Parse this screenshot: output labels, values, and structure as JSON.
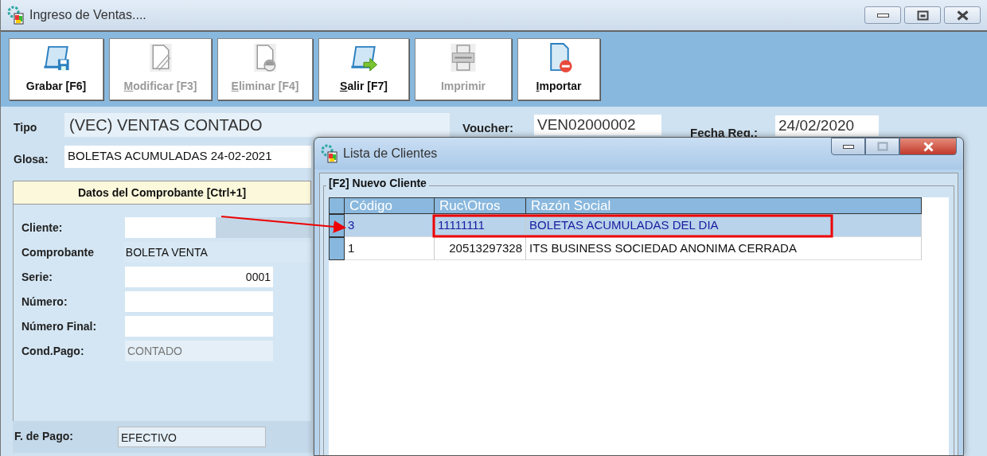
{
  "window": {
    "title": "Ingreso de Ventas...."
  },
  "toolbar": [
    {
      "label": "Grabar [F6]",
      "disabled": false,
      "mnemonic": false
    },
    {
      "label": "Modificar [F3]",
      "disabled": true,
      "mnemonic": true
    },
    {
      "label": "Eliminar [F4]",
      "disabled": true,
      "mnemonic": true
    },
    {
      "label": "Salir [F7]",
      "disabled": false,
      "mnemonic": true
    },
    {
      "label": "Imprimir",
      "disabled": true,
      "mnemonic": false
    },
    {
      "label": "Importar",
      "disabled": false,
      "mnemonic": true
    }
  ],
  "header": {
    "tipo_label": "Tipo",
    "tipo_value": "(VEC) VENTAS CONTADO",
    "voucher_label": "Voucher:",
    "voucher_value": "VEN02000002",
    "fecha_label": "Fecha Reg.:",
    "fecha_value": "24/02/2020",
    "glosa_label": "Glosa:",
    "glosa_value": "BOLETAS ACUMULADAS 24-02-2021"
  },
  "tab": {
    "label": "Datos del Comprobante [Ctrl+1]",
    "selected": true
  },
  "fields": [
    {
      "label": "Cliente:",
      "kind": "lookup"
    },
    {
      "label": "Comprobante",
      "value": "BOLETA VENTA",
      "kind": "readonly"
    },
    {
      "label": "Serie:",
      "value": "0001",
      "kind": "numeric"
    },
    {
      "label": "Número:",
      "kind": "text"
    },
    {
      "label": "Número Final:",
      "kind": "text"
    },
    {
      "label": "Cond.Pago:",
      "value": "CONTADO",
      "kind": "disabled"
    }
  ],
  "payment": {
    "label": "F. de Pago:",
    "value": "EFECTIVO"
  },
  "dialog": {
    "title": "Lista de Clientes",
    "group": "[F2] Nuevo Cliente",
    "columns": [
      "Código",
      "Ruc\\Otros",
      "Razón Social"
    ],
    "rows": [
      {
        "cells": [
          "3",
          "11111111",
          "BOLETAS  ACUMULADAS DEL DIA"
        ],
        "selected": true
      },
      {
        "cells": [
          "1",
          "20513297328",
          "ITS BUSINESS SOCIEDAD ANONIMA CERRADA"
        ],
        "selected": false
      }
    ]
  }
}
